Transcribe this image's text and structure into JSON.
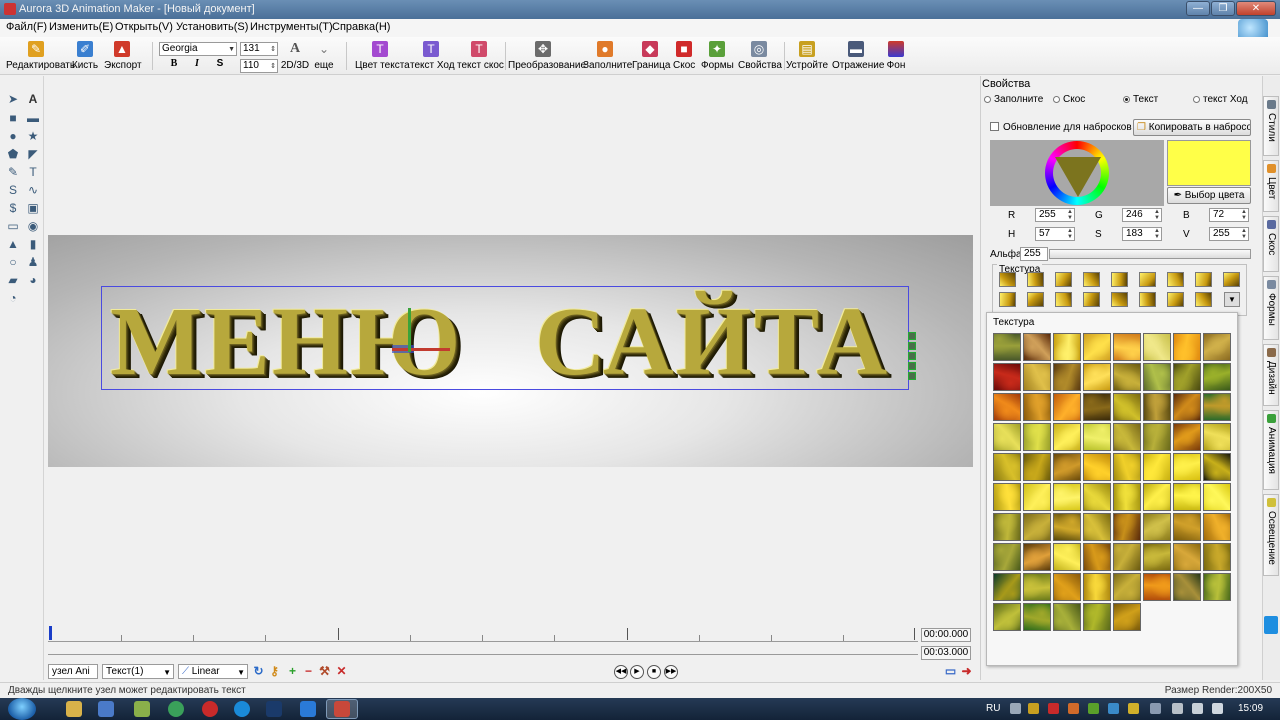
{
  "window": {
    "title": "Aurora 3D Animation Maker - [Новый документ]",
    "min": "—",
    "max": "❐",
    "close": "✕"
  },
  "menu": [
    "Файл(F)",
    "Изменить(E)",
    "Открыть(V)",
    "Установить(S)",
    "Инструменты(T)",
    "Справка(H)"
  ],
  "toolbar": {
    "edit": "Редактировать",
    "brush": "Кисть",
    "export": "Экспорт",
    "font_name": "Georgia",
    "font_size": "131",
    "font_size2": "110",
    "mode": "2D/3D",
    "more": "еще",
    "bold": "B",
    "italic": "I",
    "shadow": "S",
    "text_color": "Цвет текста",
    "text_path": "текст Ход",
    "text_bevel": "текст скос",
    "transform": "Преобразование",
    "fill": "Заполните",
    "border": "Граница",
    "bevel": "Скос",
    "shapes": "Формы",
    "properties": "Свойства",
    "device": "Устройте",
    "reflection": "Отражение",
    "background": "Фон"
  },
  "canvas": {
    "text": "МЕНЮ САЙТА",
    "word1": "МЕНЮ",
    "word2": "САЙТА"
  },
  "timeline": {
    "time_current": "00:00.000",
    "time_total": "00:03.000",
    "node_combo": "узел Ani",
    "object_combo": "Текст(1)",
    "interp_combo": "Linear"
  },
  "status": {
    "hint": "Дважды щелкните узел может редактировать текст",
    "render_size": "Размер Render:200X50"
  },
  "props": {
    "title": "Свойства",
    "radios": [
      "Заполните",
      "Скос",
      "Текст",
      "текст Ход"
    ],
    "selected_radio": "Текст",
    "update_sketch": "Обновление для набросков",
    "copy_to_sketch": "Копировать в набросок",
    "pick_color": "Выбор цвета",
    "r_label": "R",
    "r_value": "255",
    "g_label": "G",
    "g_value": "246",
    "b_label": "B",
    "b_value": "72",
    "h_label": "H",
    "h_value": "57",
    "s_label": "S",
    "s_value": "183",
    "v_label": "V",
    "v_value": "255",
    "alpha_label": "Альфа",
    "alpha_value": "255",
    "texture_label": "Текстура",
    "swatch_color": "#ffff48"
  },
  "texture_popup": {
    "title": "Текстура",
    "count": 77
  },
  "side_tabs": [
    "Стили",
    "Цвет",
    "Скос",
    "Формы",
    "Дизайн",
    "Анимация",
    "Освещение"
  ],
  "tray": {
    "lang": "RU",
    "clock": "15:09"
  }
}
